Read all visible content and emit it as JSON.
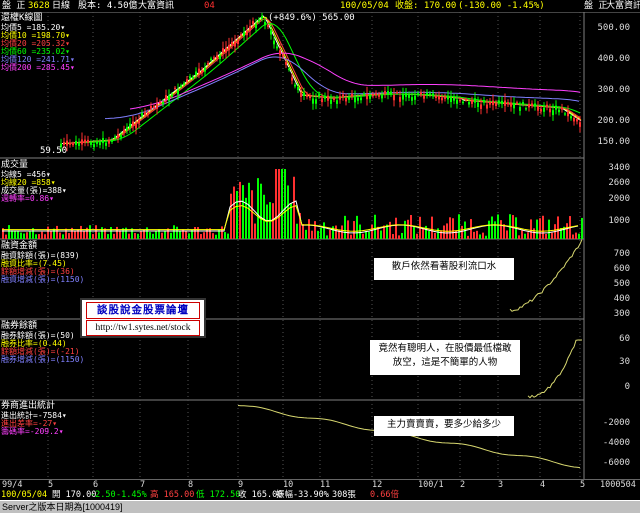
{
  "topbar": {
    "mode": "盤 正",
    "code": "3628",
    "period": "日線",
    "shares": "股本: 4.50億",
    "name": "大富資訊",
    "num": "04",
    "date": "100/05/04",
    "close": "收盤: 170.00",
    "change": "(-130.00 -1.45%)",
    "right_mode": "盤 正",
    "right_name": "大富資訊"
  },
  "price_panel": {
    "title": "還權K線圖",
    "legend": [
      "均價5 =185.20▾",
      "均價10 =198.70▾",
      "均價20 =205.32▾",
      "均價60 =235.02▾",
      "均價120 =241.71▾",
      "均價200 =285.45▾"
    ],
    "peak_label": "(+849.6%) 565.00",
    "low_label": "59.50",
    "axis_ticks": [
      "500.00",
      "400.00",
      "300.00",
      "200.00",
      "150.00"
    ]
  },
  "volume_panel": {
    "title": "成交量",
    "legend": [
      "均線5 =456▾",
      "均線20 =858▾",
      "成交量(張)=388▾",
      "週轉率=0.86▾"
    ],
    "axis_ticks": [
      "3400",
      "2600",
      "2000",
      "1000"
    ]
  },
  "margin_panel": {
    "title": "融資金額",
    "legend": [
      "融資餘額(張)=(839)",
      "融資比率=(7.45)",
      "餘額增減(張)=(36)",
      "融資增減(張)=(1150)"
    ],
    "axis_ticks": [
      "700",
      "600",
      "500",
      "400",
      "300"
    ],
    "annotation": "散戶依然看著股利流口水"
  },
  "short_panel": {
    "title": "融券餘額",
    "legend": [
      "融券餘額(張)=(50)",
      "融券比率=(0.44)",
      "餘額增減(張)=(-21)",
      "融券增減(張)=(1150)"
    ],
    "axis_ticks": [
      "60",
      "30",
      "0"
    ],
    "annotation": "竟然有聰明人，在股價最低檔敢放空，這是不簡單的人物"
  },
  "broker_panel": {
    "title": "券商進出統計",
    "legend": [
      "進出統計=-7584▾",
      "進出差率=-27▾",
      "籌碼率=-209.2▾"
    ],
    "axis_ticks": [
      "-2000",
      "-4000",
      "-6000"
    ],
    "annotation": "主力賣賣賣，要多少給多少"
  },
  "forum": {
    "title": "談股說金股票論壇",
    "url": "http://tw1.sytes.net/stock"
  },
  "dates": [
    "99/4",
    "5",
    "6",
    "7",
    "8",
    "9",
    "10",
    "11",
    "12",
    "100/1",
    "2",
    "3",
    "4",
    "5"
  ],
  "date_right": "1000504",
  "bottom": {
    "date": "100/05/04",
    "open": "開 170.00",
    "chg": "-2.50",
    "pct": "-1.45%",
    "high": "高 165.00",
    "low": "低 172.50",
    "close": "收 165.00",
    "turn": "振幅-33.90%",
    "vol": "308張",
    "ratio": "0.66倍"
  },
  "statusbar": {
    "text": "Server之版本日期為[1000419]"
  },
  "colors": {
    "ma5": "#ffffff",
    "ma10": "#ffff00",
    "ma20": "#ff4040",
    "ma60": "#00ff00",
    "ma120": "#8080ff",
    "ma200": "#ff40ff",
    "candle_up": "#ff3030",
    "candle_down": "#00ff00",
    "curve": "#d8d870"
  }
}
